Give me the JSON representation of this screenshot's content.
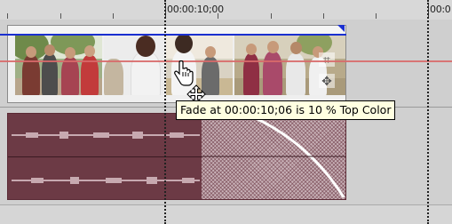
{
  "timeline": {
    "ruler": {
      "time_label_main": "00:00:10;00",
      "time_label_right": "00:0"
    },
    "tooltip": {
      "text": "Fade at 00:00:10;06 is 10 % Top Color"
    },
    "icons": {
      "crop": "crop-icon",
      "pan": "pan-crop-icon",
      "hand": "hand-cursor-icon",
      "move": "move-cursor-icon"
    },
    "colors": {
      "fade_line": "#1a2fd0",
      "cursor_line": "#d86a6a",
      "audio_event": "#6c3a45",
      "tooltip_bg": "#ffffe1"
    }
  }
}
